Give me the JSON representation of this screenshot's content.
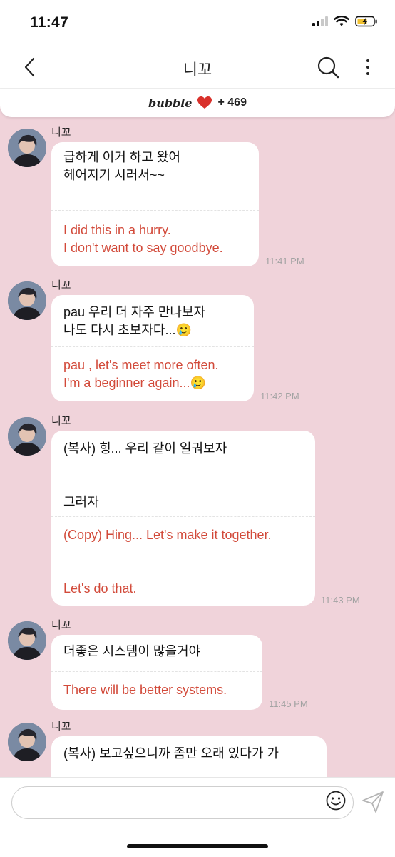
{
  "status_bar": {
    "time": "11:47"
  },
  "header": {
    "title": "니꼬"
  },
  "banner": {
    "brand": "bubble",
    "count": "+ 469",
    "heart_color": "#d9312b"
  },
  "messages": [
    {
      "sender": "니꼬",
      "korean": "급하게 이거 하고 왔어\n헤어지기 시러서~~",
      "english": "I did this in a hurry.\nI don't want to say goodbye.",
      "time": "11:41 PM"
    },
    {
      "sender": "니꼬",
      "korean": "pau 우리 더 자주 만나보자\n나도 다시 초보자다...🥲",
      "english": "pau , let's meet more often.\nI'm a beginner again...🥲",
      "time": "11:42 PM"
    },
    {
      "sender": "니꼬",
      "korean": "(복사) 힝... 우리 같이 일궈보자\n\n\n그러자",
      "english": "(Copy) Hing... Let's make it together.\n\n\nLet's do that.",
      "time": "11:43 PM"
    },
    {
      "sender": "니꼬",
      "korean": "더좋은 시스템이 많을거야",
      "english": "There will be better systems.",
      "time": "11:45 PM"
    },
    {
      "sender": "니꼬",
      "korean": "(복사) 보고싶으니까 좀만 오래 있다가 가",
      "english": "",
      "time": ""
    }
  ],
  "colors": {
    "background": "#f0d3da",
    "translation_text": "#d24a3a",
    "timestamp": "#a3a3a3"
  }
}
